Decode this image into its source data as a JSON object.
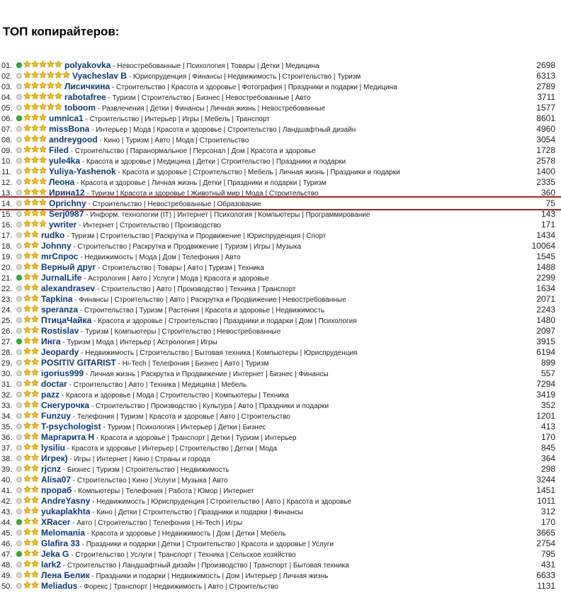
{
  "title": "ТОП копирайтеров:",
  "colors": {
    "star": "#f5c400",
    "star_stroke": "#c48a00",
    "name": "#0a3a7a",
    "highlight": "#a3271c",
    "online": "#2fb52f"
  },
  "rows": [
    {
      "num": "01.",
      "online": true,
      "stars": 5,
      "name": "polyakovka",
      "cats": "Невостребованные | Психология | Товары | Детки | Медицина",
      "count": "2698"
    },
    {
      "num": "02.",
      "online": false,
      "stars": 6,
      "name": "Vyacheslav B",
      "cats": "Юриспруденция | Финансы | Недвижимость | Строительство | Туризм",
      "count": "6313"
    },
    {
      "num": "03.",
      "online": false,
      "stars": 5,
      "name": "Лисичкина",
      "cats": "Строительство | Красота и здоровье | Фотография | Праздники и подарки | Медицина",
      "count": "2789"
    },
    {
      "num": "04.",
      "online": false,
      "stars": 5,
      "name": "rabotafree",
      "cats": "Туризм | Строительство | Бизнес | Невостребованные | Авто",
      "count": "3711"
    },
    {
      "num": "05.",
      "online": false,
      "stars": 5,
      "name": "toboom",
      "cats": "Развлечения | Детки | Финансы | Личная жизнь | Невостребованные",
      "count": "1577"
    },
    {
      "num": "06.",
      "online": true,
      "stars": 3,
      "name": "umnica1",
      "cats": "Строительство | Интерьер | Игры | Мебель | Транспорт",
      "count": "8601"
    },
    {
      "num": "07.",
      "online": false,
      "stars": 3,
      "name": "missBona",
      "cats": "Интерьер | Мода | Красота и здоровье | Строительство | Ландшафтный дизайн",
      "count": "4960"
    },
    {
      "num": "08.",
      "online": false,
      "stars": 3,
      "name": "andreygood",
      "cats": "Кино | Туризм | Авто | Мода | Строительство",
      "count": "3054"
    },
    {
      "num": "09.",
      "online": false,
      "stars": 3,
      "name": "Filed",
      "cats": "Строительство | Паранормальное | Персонал | Дом | Красота и здоровье",
      "count": "1728"
    },
    {
      "num": "10.",
      "online": false,
      "stars": 3,
      "name": "yule4ka",
      "cats": "Красота и здоровье | Медицина | Детки | Строительство | Праздники и подарки",
      "count": "2578"
    },
    {
      "num": "11.",
      "online": false,
      "stars": 3,
      "name": "Yuliya-Yashenok",
      "cats": "Красота и здоровье | Строительство | Мебель | Личная жизнь | Праздники и подарки",
      "count": "1400"
    },
    {
      "num": "12.",
      "online": false,
      "stars": 3,
      "name": "Леона",
      "cats": "Красота и здоровье | Личная жизнь | Детки | Праздники и подарки | Туризм",
      "count": "2335"
    },
    {
      "num": "13.",
      "online": false,
      "stars": 3,
      "name": "Ирина12",
      "cats": "Туризм | Красота и здоровье | Животный мир | Мода | Строительство",
      "count": "360"
    },
    {
      "num": "14.",
      "online": false,
      "stars": 3,
      "name": "Oprichny",
      "cats": "Строительство | Невостребованные | Образование",
      "count": "75"
    },
    {
      "num": "15.",
      "online": false,
      "stars": 3,
      "name": "Serj0987",
      "cats": "Информ. технологии (IT) | Интернет | Психология | Компьютеры | Программирование",
      "count": "143"
    },
    {
      "num": "16.",
      "online": false,
      "stars": 3,
      "name": "ywriter",
      "cats": "Интернет | Строительство | Производство",
      "count": "171"
    },
    {
      "num": "17.",
      "online": false,
      "stars": 2,
      "name": "rudko",
      "cats": "Туризм | Строительство | Раскрутка и Продвижение | Юриспруденция | Спорт",
      "count": "1434"
    },
    {
      "num": "18.",
      "online": false,
      "stars": 2,
      "name": "Johnny",
      "cats": "Строительство | Раскрутка и Продвижение | Туризм | Игры | Музыка",
      "count": "10064"
    },
    {
      "num": "19.",
      "online": false,
      "stars": 2,
      "name": "mrСпрос",
      "cats": "Недвижимость | Мода | Дом | Телефония | Авто",
      "count": "1545"
    },
    {
      "num": "20.",
      "online": false,
      "stars": 2,
      "name": "Верный друг",
      "cats": "Строительство | Товары | Авто | Туризм | Техника",
      "count": "1488"
    },
    {
      "num": "21.",
      "online": true,
      "stars": 2,
      "name": "JurnalLife",
      "cats": "Астрология | Авто | Услуги | Мода | Красота и здоровье",
      "count": "2299"
    },
    {
      "num": "22.",
      "online": false,
      "stars": 2,
      "name": "alexandrasev",
      "cats": "Строительство | Авто | Производство | Техника | Транспорт",
      "count": "1634"
    },
    {
      "num": "23.",
      "online": false,
      "stars": 2,
      "name": "Tapkina",
      "cats": "Финансы | Строительство | Авто | Раскрутка и Продвижение | Невостребованные",
      "count": "2071"
    },
    {
      "num": "24.",
      "online": false,
      "stars": 2,
      "name": "speranza",
      "cats": "Строительство | Туризм | Растения | Красота и здоровье | Недвижимость",
      "count": "2243"
    },
    {
      "num": "25.",
      "online": false,
      "stars": 2,
      "name": "ПтицаЧайка",
      "cats": "Красота и здоровье | Строительство | Праздники и подарки | Дом | Психология",
      "count": "1480"
    },
    {
      "num": "26.",
      "online": false,
      "stars": 2,
      "name": "Rostislav",
      "cats": "Туризм | Компьютеры | Строительство | Невостребованные",
      "count": "2097"
    },
    {
      "num": "27.",
      "online": true,
      "stars": 2,
      "name": "Инга",
      "cats": "Туризм | Мода | Интерьер | Астрология | Игры",
      "count": "3915"
    },
    {
      "num": "28.",
      "online": false,
      "stars": 2,
      "name": "Jeopardy",
      "cats": "Недвижимость | Строительство | Бытовая техника | Компьютеры | Юриспруденция",
      "count": "6194"
    },
    {
      "num": "29.",
      "online": false,
      "stars": 2,
      "name": "POSITIV GITARIST",
      "cats": "Hi-Tech | Телефония | Бизнес | Авто | Туризм",
      "count": "899"
    },
    {
      "num": "30.",
      "online": false,
      "stars": 2,
      "name": "igorius999",
      "cats": "Личная жизнь | Раскрутка и Продвижение | Интернет | Бизнес | Финансы",
      "count": "557"
    },
    {
      "num": "31.",
      "online": false,
      "stars": 2,
      "name": "doctar",
      "cats": "Строительство | Авто | Техника | Медицина | Мебель",
      "count": "7294"
    },
    {
      "num": "32.",
      "online": false,
      "stars": 2,
      "name": "pazz",
      "cats": "Красота и здоровье | Мода | Строительство | Компьютеры | Техника",
      "count": "3419"
    },
    {
      "num": "33.",
      "online": false,
      "stars": 2,
      "name": "Снегурочка",
      "cats": "Строительство | Производство | Культура | Авто | Праздники и подарки",
      "count": "352"
    },
    {
      "num": "34.",
      "online": false,
      "stars": 2,
      "name": "Funzuy",
      "cats": "Телефония | Туризм | Красота и здоровье | Авто | Строительство",
      "count": "1201"
    },
    {
      "num": "35.",
      "online": false,
      "stars": 2,
      "name": "T-psychologist",
      "cats": "Туризм | Психология | Интерьер | Детки | Бизнес",
      "count": "413"
    },
    {
      "num": "36.",
      "online": false,
      "stars": 2,
      "name": "Маргарита Н",
      "cats": "Красота и здоровье | Транспорт | Детки | Туризм | Интерьер",
      "count": "170"
    },
    {
      "num": "37.",
      "online": false,
      "stars": 2,
      "name": "lysiliu",
      "cats": "Красота и здоровье | Интерьер | Строительство | Детки | Мода",
      "count": "845"
    },
    {
      "num": "38.",
      "online": false,
      "stars": 2,
      "name": "Игрек)",
      "cats": "Игры | Интернет | Кино | Страны и города",
      "count": "364"
    },
    {
      "num": "39.",
      "online": false,
      "stars": 2,
      "name": "rjcnz",
      "cats": "Бизнес | Туризм | Строительство | Недвижимость",
      "count": "298"
    },
    {
      "num": "40.",
      "online": false,
      "stars": 2,
      "name": "Alisa07",
      "cats": "Строительство | Кино | Услуги | Музыка | Авто",
      "count": "3244"
    },
    {
      "num": "41.",
      "online": false,
      "stars": 2,
      "name": "прораб",
      "cats": "Компьютеры | Телефония | Работа | Юмор | Интернет",
      "count": "1451"
    },
    {
      "num": "42.",
      "online": false,
      "stars": 2,
      "name": "AndreYasny",
      "cats": "Недвижимость | Юриспруденция | Строительство | Авто | Красота и здоровье",
      "count": "1011"
    },
    {
      "num": "43.",
      "online": false,
      "stars": 2,
      "name": "yukaplakhta",
      "cats": "Кино | Детки | Строительство | Праздники и подарки | Финансы",
      "count": "312"
    },
    {
      "num": "44.",
      "online": true,
      "stars": 2,
      "name": "XRacer",
      "cats": "Авто | Строительство | Телефония | Hi-Tech | Игры",
      "count": "170"
    },
    {
      "num": "45.",
      "online": false,
      "stars": 2,
      "name": "Melomania",
      "cats": "Красота и здоровье | Недвижимость | Дом | Детки | Мебель",
      "count": "3665"
    },
    {
      "num": "46.",
      "online": false,
      "stars": 2,
      "name": "Glafira 33",
      "cats": "Праздники и подарки | Детки | Строительство | Красота и здоровье | Услуги",
      "count": "2754"
    },
    {
      "num": "47.",
      "online": true,
      "stars": 2,
      "name": "Jeka G",
      "cats": "Строительство | Услуги | Транспорт | Техника | Сельское хозяйство",
      "count": "795"
    },
    {
      "num": "48.",
      "online": false,
      "stars": 2,
      "name": "lark2",
      "cats": "Строительство | Ландшафтный дизайн | Производство | Транспорт | Бытовая техника",
      "count": "431"
    },
    {
      "num": "49.",
      "online": false,
      "stars": 2,
      "name": "Лена Белик",
      "cats": "Праздники и подарки | Недвижимость | Дом | Интерьер | Личная жизнь",
      "count": "6633"
    },
    {
      "num": "50.",
      "online": false,
      "stars": 2,
      "name": "Meliadus",
      "cats": "Форекс | Транспорт | Недвижимость | Авто | Строительство",
      "count": "1131"
    }
  ]
}
